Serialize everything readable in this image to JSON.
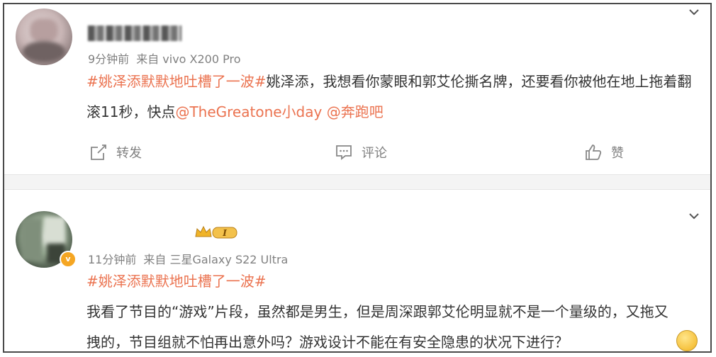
{
  "posts": [
    {
      "username": "",
      "time": "9分钟前",
      "source": "来自 vivo X200 Pro",
      "content": {
        "hashtag": "#姚泽添默默地吐槽了一波#",
        "text": "姚泽添，我想看你蒙眼和郭艾伦撕名牌，还要看你被他在地上拖着翻滚11秒，快点",
        "mention1": "@TheGreatone小day",
        "mention2": "@奔跑吧"
      },
      "actions": {
        "repost": "转发",
        "comment": "评论",
        "like": "赞"
      }
    },
    {
      "username": "",
      "time": "11分钟前",
      "source": "来自 三星Galaxy S22 Ultra",
      "badge_level": "I",
      "verified_mark": "v",
      "content": {
        "hashtag": "#姚泽添默默地吐槽了一波#",
        "text": "我看了节目的“游戏”片段，虽然都是男生，但是周深跟郭艾伦明显就不是一个量级的，又拖又拽的，节目组就不怕再出意外吗？游戏设计不能在有安全隐患的状况下进行？"
      }
    }
  ],
  "colors": {
    "accent": "#eb7350",
    "muted": "#808080",
    "text": "#333333",
    "border": "#4a4a4a"
  },
  "icons": [
    "chevron-down-icon",
    "repost-icon",
    "comment-icon",
    "like-icon",
    "crown-badge-icon",
    "verified-icon",
    "emoji-icon"
  ]
}
